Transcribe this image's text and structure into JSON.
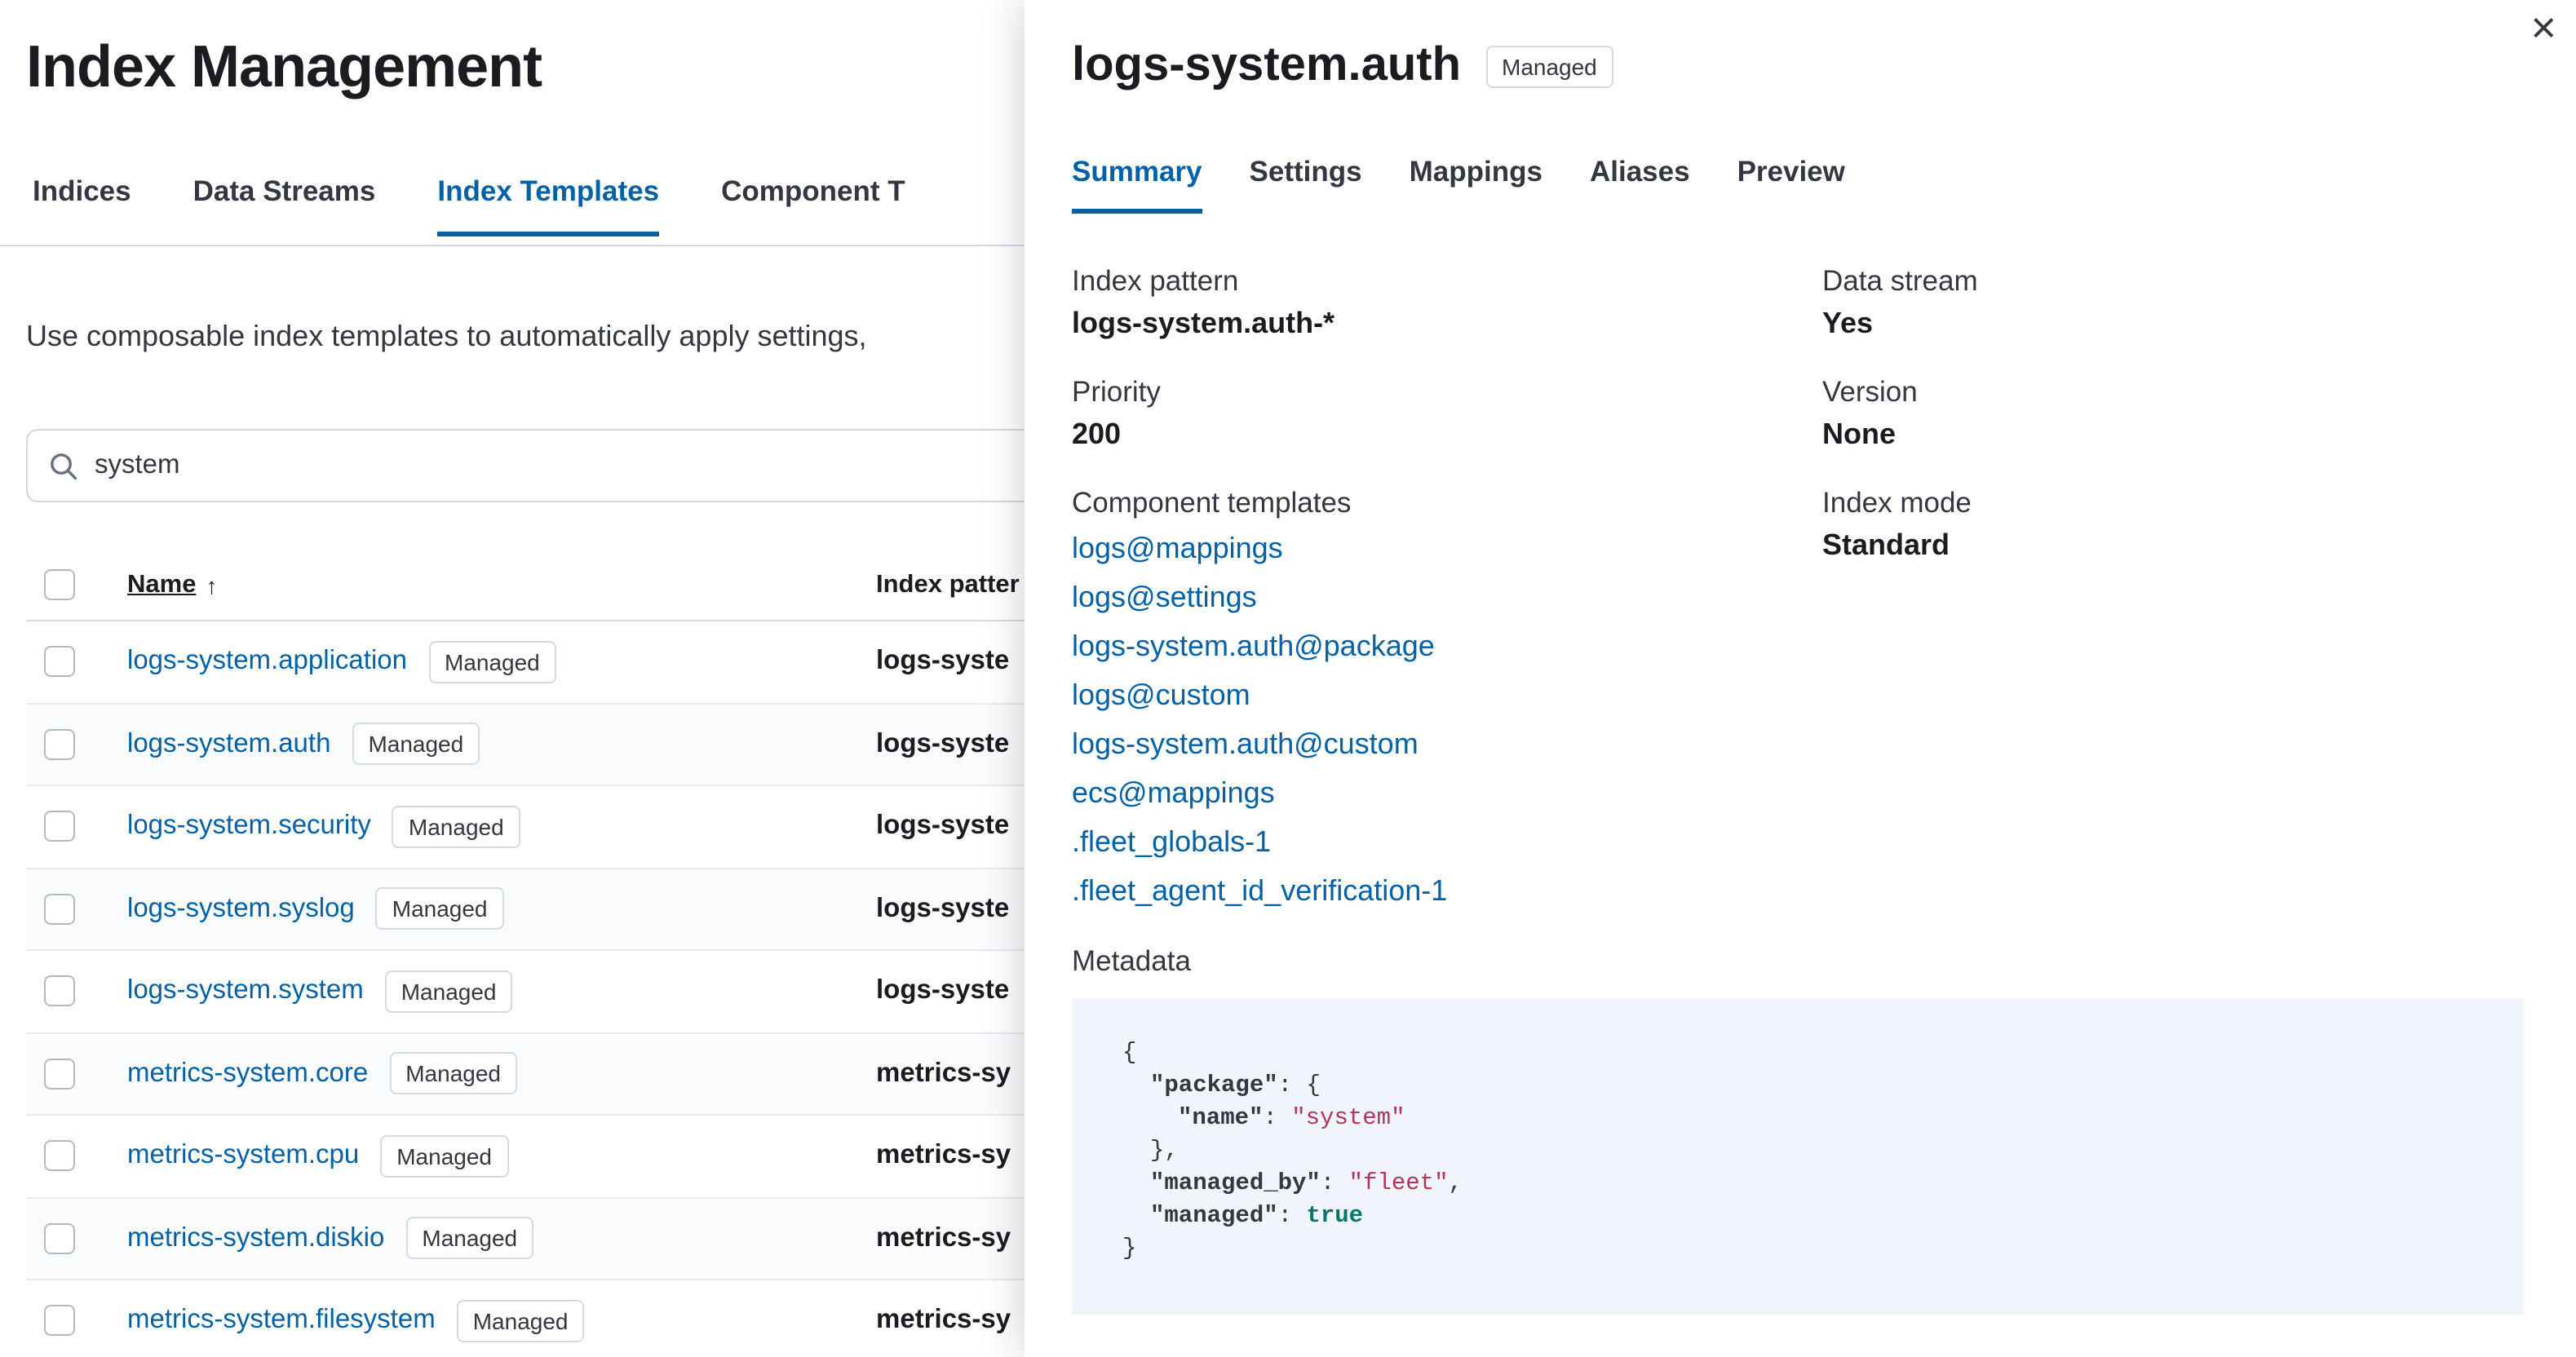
{
  "colors": {
    "primary": "#0061a6",
    "text": "#343741",
    "heading_text": "#1a1c21",
    "border": "#d3dae6",
    "code_background": "#f1f4fa",
    "code_string": "#b0365c",
    "code_boolean": "#00756b"
  },
  "page": {
    "title": "Index Management",
    "tabs": [
      {
        "label": "Indices"
      },
      {
        "label": "Data Streams"
      },
      {
        "label": "Index Templates"
      },
      {
        "label": "Component T"
      }
    ],
    "description": "Use composable index templates to automatically apply settings,",
    "search": {
      "value": "system",
      "icon": "search-icon"
    },
    "table": {
      "header": {
        "name": "Name",
        "sort_arrow": "↑",
        "index_pattern": "Index patter"
      },
      "rows": [
        {
          "name": "logs-system.application",
          "badge": "Managed",
          "pattern": "logs-syste"
        },
        {
          "name": "logs-system.auth",
          "badge": "Managed",
          "pattern": "logs-syste"
        },
        {
          "name": "logs-system.security",
          "badge": "Managed",
          "pattern": "logs-syste"
        },
        {
          "name": "logs-system.syslog",
          "badge": "Managed",
          "pattern": "logs-syste"
        },
        {
          "name": "logs-system.system",
          "badge": "Managed",
          "pattern": "logs-syste"
        },
        {
          "name": "metrics-system.core",
          "badge": "Managed",
          "pattern": "metrics-sy"
        },
        {
          "name": "metrics-system.cpu",
          "badge": "Managed",
          "pattern": "metrics-sy"
        },
        {
          "name": "metrics-system.diskio",
          "badge": "Managed",
          "pattern": "metrics-sy"
        },
        {
          "name": "metrics-system.filesystem",
          "badge": "Managed",
          "pattern": "metrics-sy"
        }
      ]
    }
  },
  "flyout": {
    "title": "logs-system.auth",
    "badge": "Managed",
    "close_icon": "×",
    "tabs": [
      {
        "label": "Summary"
      },
      {
        "label": "Settings"
      },
      {
        "label": "Mappings"
      },
      {
        "label": "Aliases"
      },
      {
        "label": "Preview"
      }
    ],
    "summary": {
      "index_pattern": {
        "label": "Index pattern",
        "value": "logs-system.auth-*"
      },
      "priority": {
        "label": "Priority",
        "value": "200"
      },
      "data_stream": {
        "label": "Data stream",
        "value": "Yes"
      },
      "version": {
        "label": "Version",
        "value": "None"
      },
      "index_mode": {
        "label": "Index mode",
        "value": "Standard"
      },
      "component_templates": {
        "label": "Component templates",
        "links": [
          "logs@mappings",
          "logs@settings",
          "logs-system.auth@package",
          "logs@custom",
          "logs-system.auth@custom",
          "ecs@mappings",
          ".fleet_globals-1",
          ".fleet_agent_id_verification-1"
        ]
      },
      "metadata": {
        "label": "Metadata",
        "code": {
          "l1": "{",
          "l2_key": "\"package\"",
          "l2_rest": ": {",
          "l3_key": "\"name\"",
          "l3_sep": ": ",
          "l3_val": "\"system\"",
          "l4": "},",
          "l5_key": "\"managed_by\"",
          "l5_sep": ": ",
          "l5_val": "\"fleet\"",
          "l5_end": ",",
          "l6_key": "\"managed\"",
          "l6_sep": ": ",
          "l6_val": "true",
          "l7": "}"
        }
      }
    }
  }
}
